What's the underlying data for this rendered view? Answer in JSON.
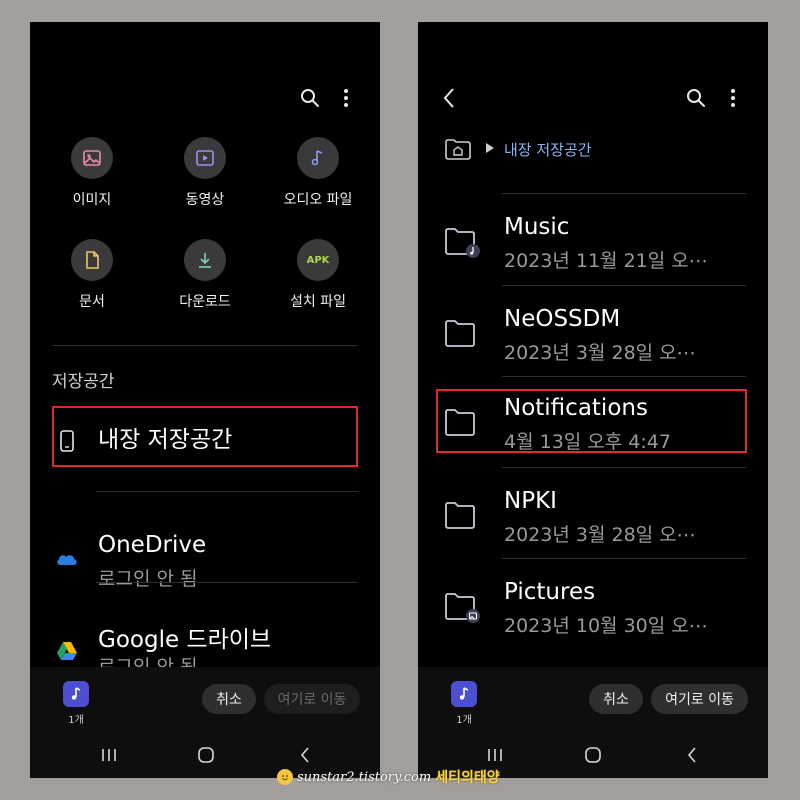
{
  "left": {
    "categories": [
      {
        "label": "이미지",
        "icon": "image-icon"
      },
      {
        "label": "동영상",
        "icon": "video-icon"
      },
      {
        "label": "오디오 파일",
        "icon": "audio-icon"
      },
      {
        "label": "문서",
        "icon": "document-icon"
      },
      {
        "label": "다운로드",
        "icon": "download-icon"
      },
      {
        "label": "설치 파일",
        "icon": "apk-icon",
        "badge_text": "APK"
      }
    ],
    "section_title": "저장공간",
    "storages": [
      {
        "name": "내장 저장공간",
        "icon": "phone-icon"
      },
      {
        "name": "OneDrive",
        "status": "로그인 안 됨",
        "icon": "onedrive-icon"
      },
      {
        "name": "Google 드라이브",
        "status": "로그인 안 됨",
        "icon": "google-drive-icon"
      }
    ],
    "bottom": {
      "count": "1개",
      "cancel": "취소",
      "move_here": "여기로 이동"
    }
  },
  "right": {
    "breadcrumb": "내장 저장공간",
    "folders": [
      {
        "name": "Music",
        "date": "2023년 11월 21일 오⋯",
        "badge": "music-note"
      },
      {
        "name": "NeOSSDM",
        "date": "2023년 3월 28일 오⋯"
      },
      {
        "name": "Notifications",
        "date": "4월 13일 오후 4:47"
      },
      {
        "name": "NPKI",
        "date": "2023년 3월 28일 오⋯"
      },
      {
        "name": "Pictures",
        "date": "2023년 10월 30일 오⋯",
        "badge": "image"
      }
    ],
    "bottom": {
      "count": "1개",
      "cancel": "취소",
      "move_here": "여기로 이동"
    }
  },
  "watermark": {
    "url": "sunstar2.tistory.com",
    "name": "세티의태양"
  },
  "colors": {
    "highlight": "#e02a2a",
    "breadcrumb": "#8bb4f2",
    "apk": "#a7d84a",
    "music_badge": "#4b4fd0"
  }
}
